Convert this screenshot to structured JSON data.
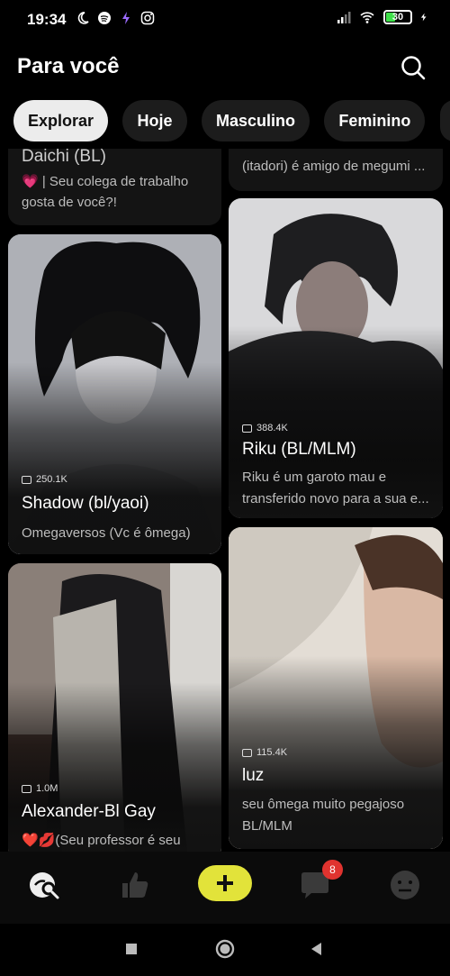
{
  "status_bar": {
    "time": "19:34",
    "battery": "30",
    "left_icons": [
      "moon-icon",
      "spotify-icon",
      "app-icon",
      "instagram-icon"
    ],
    "right_icons": [
      "signal-icon",
      "wifi-icon",
      "battery-icon",
      "charging-icon"
    ]
  },
  "header": {
    "title": "Para você",
    "search_icon": "search-icon"
  },
  "chips": [
    {
      "label": "Explorar",
      "active": true
    },
    {
      "label": "Hoje",
      "active": false
    },
    {
      "label": "Masculino",
      "active": false
    },
    {
      "label": "Feminino",
      "active": false
    }
  ],
  "cards": {
    "daichi": {
      "name": "Daichi (BL)",
      "desc_line1": "💗 | Seu colega de trabalho",
      "desc_line2": "gosta de você?!"
    },
    "itadori": {
      "desc": "(itadori) é amigo de megumi ..."
    },
    "shadow": {
      "count": "250.1K",
      "name": "Shadow (bl/yaoi)",
      "desc": "Omegaversos (Vc é ômega)"
    },
    "riku": {
      "count": "388.4K",
      "name": "Riku (BL/MLM)",
      "desc_line1": "Riku é um garoto mau e",
      "desc_line2": "transferido novo para a sua e..."
    },
    "alexander": {
      "count": "1.0M",
      "name": "Alexander-Bl Gay",
      "desc": "❤️💋(Seu professor é seu"
    },
    "luz": {
      "count": "115.4K",
      "name": "luz",
      "desc_line1": "seu ômega muito pegajoso",
      "desc_line2": "BL/MLM"
    }
  },
  "bottom_nav": {
    "items": [
      "explore-icon",
      "likes-icon",
      "create-button",
      "chat-icon",
      "profile-icon"
    ],
    "chat_badge": "8",
    "accent": "#e2e33a"
  }
}
